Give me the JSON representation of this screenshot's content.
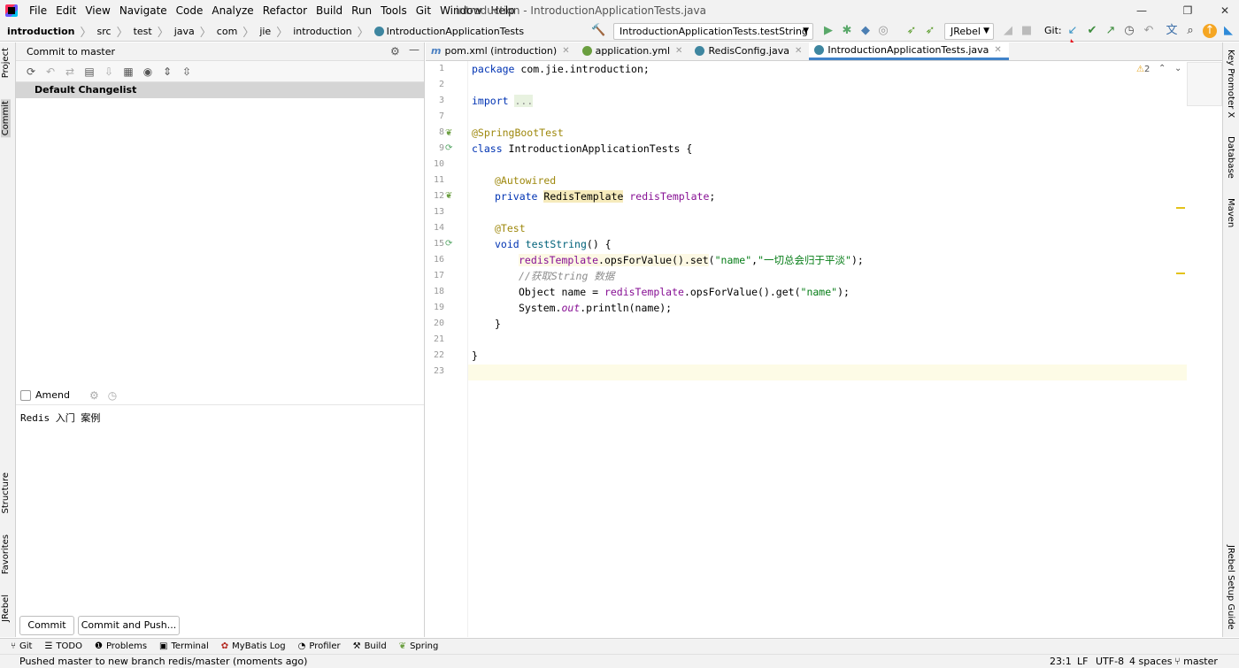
{
  "menu": [
    "File",
    "Edit",
    "View",
    "Navigate",
    "Code",
    "Analyze",
    "Refactor",
    "Build",
    "Run",
    "Tools",
    "Git",
    "Window",
    "Help"
  ],
  "window_title": "introduction - IntroductionApplicationTests.java",
  "breadcrumb": [
    "introduction",
    "src",
    "test",
    "java",
    "com",
    "jie",
    "introduction",
    "IntroductionApplicationTests"
  ],
  "run_config": "IntroductionApplicationTests.testString",
  "jrebel_combo": "JRebel",
  "git_label": "Git:",
  "commit_panel": {
    "title": "Commit to master",
    "changelist": "Default Changelist",
    "amend_label": "Amend",
    "commit_message": "Redis 入门 案例",
    "commit_button": "Commit",
    "commit_push_button": "Commit and Push..."
  },
  "left_tabs": [
    "Project",
    "Commit",
    "Structure",
    "Favorites",
    "JRebel"
  ],
  "right_tabs": [
    "Key Promoter X",
    "Database",
    "Maven",
    "JRebel Setup Guide"
  ],
  "editor_tabs": [
    {
      "label": "pom.xml (introduction)",
      "icon": "maven-file-icon",
      "color": "#4a7fc1"
    },
    {
      "label": "application.yml",
      "icon": "yaml-file-icon",
      "color": "#6a9e3f"
    },
    {
      "label": "RedisConfig.java",
      "icon": "java-class-icon",
      "color": "#3e86a0"
    },
    {
      "label": "IntroductionApplicationTests.java",
      "icon": "java-class-icon",
      "color": "#3e86a0",
      "active": true
    }
  ],
  "warnings": "2",
  "line_numbers": [
    "1",
    "2",
    "3",
    "7",
    "8",
    "9",
    "10",
    "11",
    "12",
    "13",
    "14",
    "15",
    "16",
    "17",
    "18",
    "19",
    "20",
    "21",
    "22",
    "23"
  ],
  "code": {
    "l1_kw": "package",
    "l1_rest": " com.jie.introduction;",
    "l3_kw": "import",
    "l3_fold": "...",
    "l8": "@SpringBootTest",
    "l9_kw": "class",
    "l9_rest": " IntroductionApplicationTests {",
    "l11": "@Autowired",
    "l12_kw": "private",
    "l12_type": "RedisTemplate",
    "l12_field": "redisTemplate",
    "l14": "@Test",
    "l15_kw": "void",
    "l15_m": "testString",
    "l15_rest": "() {",
    "l16_field": "redisTemplate",
    "l16_a": ".opsForValue().",
    "l16_set": "set",
    "l16_b": "(",
    "l16_s1": "\"name\"",
    "l16_c": ",",
    "l16_s2": "\"一切总会归于平淡\"",
    "l16_d": ");",
    "l17": "//获取String 数据",
    "l18_a": "Object name = ",
    "l18_field": "redisTemplate",
    "l18_b": ".opsForValue().get(",
    "l18_s": "\"name\"",
    "l18_c": ");",
    "l19_a": "System.",
    "l19_out": "out",
    "l19_b": ".println(name);",
    "l20": "}",
    "l22": "}"
  },
  "bottom_tools": [
    {
      "label": "Git",
      "icon": "git-icon"
    },
    {
      "label": "TODO",
      "icon": "todo-icon"
    },
    {
      "label": "Problems",
      "icon": "problems-icon"
    },
    {
      "label": "Terminal",
      "icon": "terminal-icon"
    },
    {
      "label": "MyBatis Log",
      "icon": "mybatis-icon"
    },
    {
      "label": "Profiler",
      "icon": "profiler-icon"
    },
    {
      "label": "Build",
      "icon": "build-icon"
    },
    {
      "label": "Spring",
      "icon": "spring-icon"
    }
  ],
  "status_message": "Pushed master to new branch redis/master (moments ago)",
  "status_right": {
    "position": "23:1",
    "line_sep": "LF",
    "encoding": "UTF-8",
    "indent": "4 spaces",
    "branch": "master"
  },
  "colors": {
    "accent": "#4083c9",
    "git_update": "#3592c4",
    "git_commit": "#3c8c3c",
    "arrow": "#e8141e"
  }
}
